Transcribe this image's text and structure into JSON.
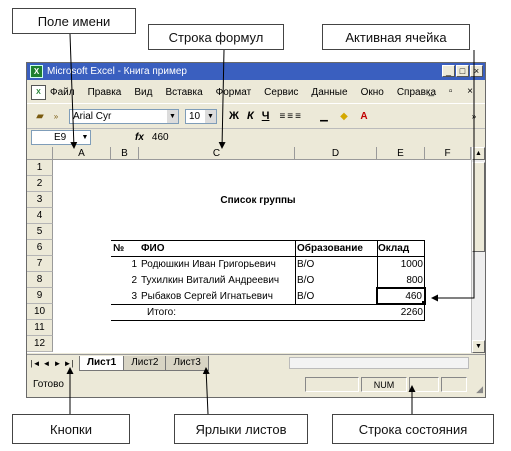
{
  "callouts": {
    "name_box": "Поле имени",
    "formula_bar": "Строка формул",
    "active_cell": "Активная ячейка",
    "nav_buttons": "Кнопки",
    "sheet_tabs": "Ярлыки листов",
    "status_bar": "Строка состояния"
  },
  "window": {
    "title": "Microsoft Excel - Книга пример",
    "buttons": [
      "_",
      "□",
      "×"
    ]
  },
  "menu": {
    "items": [
      "Файл",
      "Правка",
      "Вид",
      "Вставка",
      "Формат",
      "Сервис",
      "Данные",
      "Окно",
      "Справка"
    ],
    "doc_controls": "_ ▫ ×"
  },
  "toolbar": {
    "font_name": "Arial Cyr",
    "font_size": "10",
    "bold": "Ж",
    "italic": "К",
    "underline": "Ч",
    "align": "≡≡≡"
  },
  "formula_bar": {
    "name_box": "E9",
    "fx": "fx",
    "value": "460"
  },
  "sheet": {
    "columns": [
      "A",
      "B",
      "C",
      "D",
      "E",
      "F"
    ],
    "rows": [
      "1",
      "2",
      "3",
      "4",
      "5",
      "6",
      "7",
      "8",
      "9",
      "10",
      "11",
      "12"
    ],
    "title": "Список группы",
    "headers": {
      "num": "№",
      "name": "ФИО",
      "edu": "Образование",
      "salary": "Оклад"
    },
    "records": [
      {
        "num": "1",
        "name": "Родюшкин Иван Григорьевич",
        "edu": "В/О",
        "salary": "1000"
      },
      {
        "num": "2",
        "name": "Тухилкин Виталий Андреевич",
        "edu": "В/О",
        "salary": "800"
      },
      {
        "num": "3",
        "name": "Рыбаков Сергей Игнатьевич",
        "edu": "В/О",
        "salary": "460"
      }
    ],
    "total_label": "Итого:",
    "total_value": "2260"
  },
  "tabs": {
    "nav": [
      "|◄",
      "◄",
      "►",
      "►|"
    ],
    "sheets": [
      "Лист1",
      "Лист2",
      "Лист3"
    ]
  },
  "status": {
    "ready": "Готово",
    "num": "NUM"
  }
}
